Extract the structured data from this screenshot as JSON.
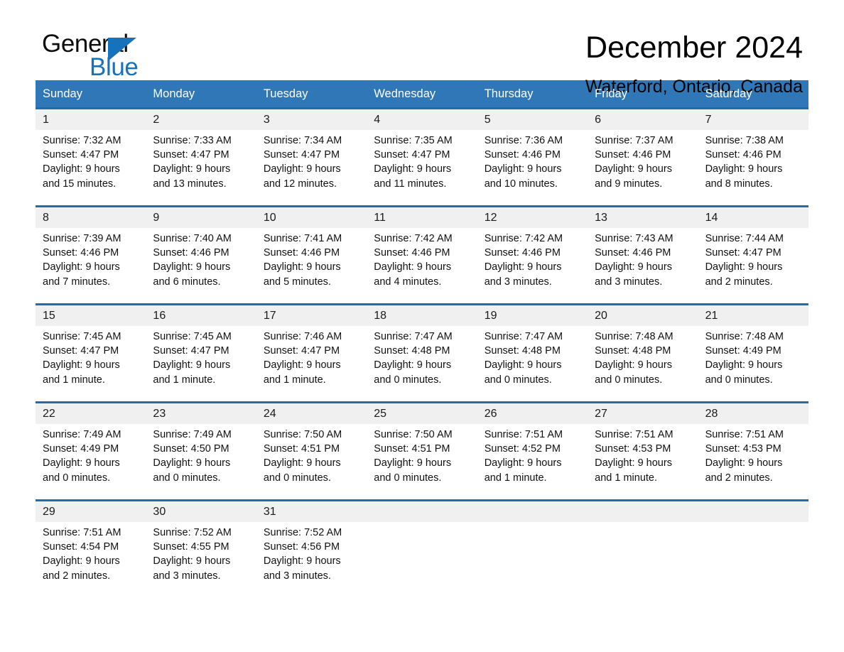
{
  "brand": {
    "name_top": "General",
    "name_bottom": "Blue",
    "accent_color": "#1673bb"
  },
  "header": {
    "title": "December 2024",
    "subtitle": "Waterford, Ontario, Canada"
  },
  "calendar": {
    "header_bg": "#2f77b7",
    "header_text_color": "#ffffff",
    "row_border_color": "#1f6cae",
    "day_band_bg": "#f0f0f0",
    "weekdays": [
      "Sunday",
      "Monday",
      "Tuesday",
      "Wednesday",
      "Thursday",
      "Friday",
      "Saturday"
    ],
    "weeks": [
      [
        {
          "day": "1",
          "info": "Sunrise: 7:32 AM\nSunset: 4:47 PM\nDaylight: 9 hours\nand 15 minutes."
        },
        {
          "day": "2",
          "info": "Sunrise: 7:33 AM\nSunset: 4:47 PM\nDaylight: 9 hours\nand 13 minutes."
        },
        {
          "day": "3",
          "info": "Sunrise: 7:34 AM\nSunset: 4:47 PM\nDaylight: 9 hours\nand 12 minutes."
        },
        {
          "day": "4",
          "info": "Sunrise: 7:35 AM\nSunset: 4:47 PM\nDaylight: 9 hours\nand 11 minutes."
        },
        {
          "day": "5",
          "info": "Sunrise: 7:36 AM\nSunset: 4:46 PM\nDaylight: 9 hours\nand 10 minutes."
        },
        {
          "day": "6",
          "info": "Sunrise: 7:37 AM\nSunset: 4:46 PM\nDaylight: 9 hours\nand 9 minutes."
        },
        {
          "day": "7",
          "info": "Sunrise: 7:38 AM\nSunset: 4:46 PM\nDaylight: 9 hours\nand 8 minutes."
        }
      ],
      [
        {
          "day": "8",
          "info": "Sunrise: 7:39 AM\nSunset: 4:46 PM\nDaylight: 9 hours\nand 7 minutes."
        },
        {
          "day": "9",
          "info": "Sunrise: 7:40 AM\nSunset: 4:46 PM\nDaylight: 9 hours\nand 6 minutes."
        },
        {
          "day": "10",
          "info": "Sunrise: 7:41 AM\nSunset: 4:46 PM\nDaylight: 9 hours\nand 5 minutes."
        },
        {
          "day": "11",
          "info": "Sunrise: 7:42 AM\nSunset: 4:46 PM\nDaylight: 9 hours\nand 4 minutes."
        },
        {
          "day": "12",
          "info": "Sunrise: 7:42 AM\nSunset: 4:46 PM\nDaylight: 9 hours\nand 3 minutes."
        },
        {
          "day": "13",
          "info": "Sunrise: 7:43 AM\nSunset: 4:46 PM\nDaylight: 9 hours\nand 3 minutes."
        },
        {
          "day": "14",
          "info": "Sunrise: 7:44 AM\nSunset: 4:47 PM\nDaylight: 9 hours\nand 2 minutes."
        }
      ],
      [
        {
          "day": "15",
          "info": "Sunrise: 7:45 AM\nSunset: 4:47 PM\nDaylight: 9 hours\nand 1 minute."
        },
        {
          "day": "16",
          "info": "Sunrise: 7:45 AM\nSunset: 4:47 PM\nDaylight: 9 hours\nand 1 minute."
        },
        {
          "day": "17",
          "info": "Sunrise: 7:46 AM\nSunset: 4:47 PM\nDaylight: 9 hours\nand 1 minute."
        },
        {
          "day": "18",
          "info": "Sunrise: 7:47 AM\nSunset: 4:48 PM\nDaylight: 9 hours\nand 0 minutes."
        },
        {
          "day": "19",
          "info": "Sunrise: 7:47 AM\nSunset: 4:48 PM\nDaylight: 9 hours\nand 0 minutes."
        },
        {
          "day": "20",
          "info": "Sunrise: 7:48 AM\nSunset: 4:48 PM\nDaylight: 9 hours\nand 0 minutes."
        },
        {
          "day": "21",
          "info": "Sunrise: 7:48 AM\nSunset: 4:49 PM\nDaylight: 9 hours\nand 0 minutes."
        }
      ],
      [
        {
          "day": "22",
          "info": "Sunrise: 7:49 AM\nSunset: 4:49 PM\nDaylight: 9 hours\nand 0 minutes."
        },
        {
          "day": "23",
          "info": "Sunrise: 7:49 AM\nSunset: 4:50 PM\nDaylight: 9 hours\nand 0 minutes."
        },
        {
          "day": "24",
          "info": "Sunrise: 7:50 AM\nSunset: 4:51 PM\nDaylight: 9 hours\nand 0 minutes."
        },
        {
          "day": "25",
          "info": "Sunrise: 7:50 AM\nSunset: 4:51 PM\nDaylight: 9 hours\nand 0 minutes."
        },
        {
          "day": "26",
          "info": "Sunrise: 7:51 AM\nSunset: 4:52 PM\nDaylight: 9 hours\nand 1 minute."
        },
        {
          "day": "27",
          "info": "Sunrise: 7:51 AM\nSunset: 4:53 PM\nDaylight: 9 hours\nand 1 minute."
        },
        {
          "day": "28",
          "info": "Sunrise: 7:51 AM\nSunset: 4:53 PM\nDaylight: 9 hours\nand 2 minutes."
        }
      ],
      [
        {
          "day": "29",
          "info": "Sunrise: 7:51 AM\nSunset: 4:54 PM\nDaylight: 9 hours\nand 2 minutes."
        },
        {
          "day": "30",
          "info": "Sunrise: 7:52 AM\nSunset: 4:55 PM\nDaylight: 9 hours\nand 3 minutes."
        },
        {
          "day": "31",
          "info": "Sunrise: 7:52 AM\nSunset: 4:56 PM\nDaylight: 9 hours\nand 3 minutes."
        },
        {
          "day": "",
          "info": ""
        },
        {
          "day": "",
          "info": ""
        },
        {
          "day": "",
          "info": ""
        },
        {
          "day": "",
          "info": ""
        }
      ]
    ]
  }
}
